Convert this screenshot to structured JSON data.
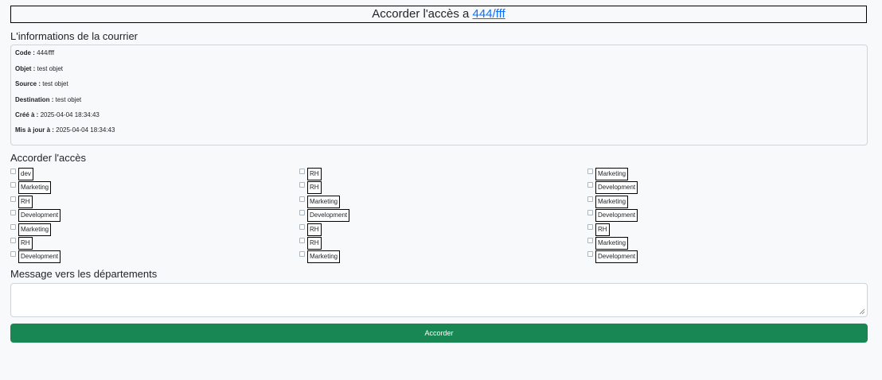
{
  "header": {
    "title_prefix": "Accorder l'accès a ",
    "title_link": "444/fff"
  },
  "info": {
    "heading": "L'informations de la courrier",
    "lines": [
      {
        "label": "Code :",
        "value": " 444/fff"
      },
      {
        "label": "Objet :",
        "value": " test objet"
      },
      {
        "label": "Source :",
        "value": " test objet"
      },
      {
        "label": "Destination :",
        "value": " test objet"
      },
      {
        "label": "Créé à :",
        "value": " 2025-04-04 18:34:43"
      },
      {
        "label": "Mis à jour à :",
        "value": " 2025-04-04 18:34:43"
      }
    ]
  },
  "access": {
    "heading": "Accorder l'accès",
    "columns": [
      [
        "dev",
        "Marketing",
        "RH",
        "Development",
        "Marketing",
        "RH",
        "Development"
      ],
      [
        "RH",
        "RH",
        "Marketing",
        "Development",
        "RH",
        "RH",
        "Marketing"
      ],
      [
        "Marketing",
        "Development",
        "Marketing",
        "Development",
        "RH",
        "Marketing",
        "Development"
      ]
    ]
  },
  "message": {
    "heading": "Message vers les départements",
    "value": ""
  },
  "submit": {
    "label": "Accorder"
  },
  "colors": {
    "primary_button": "#198754",
    "link": "#0d6efd"
  }
}
